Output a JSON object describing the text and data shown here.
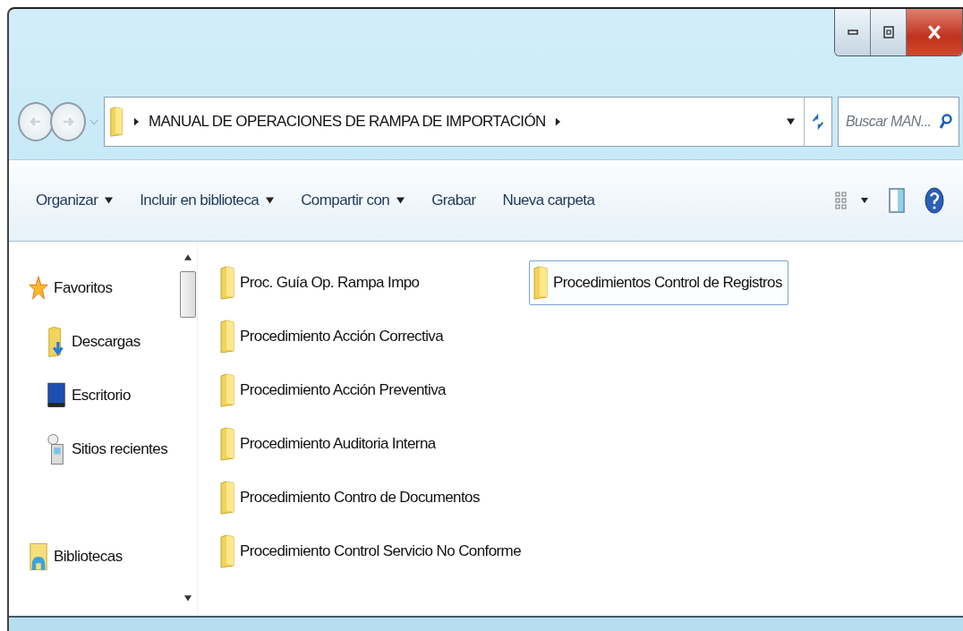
{
  "address_bar": {
    "path": "MANUAL DE OPERACIONES DE RAMPA DE IMPORTACIÓN"
  },
  "search": {
    "placeholder": "Buscar MAN..."
  },
  "toolbar": [
    {
      "label": "Organizar",
      "dropdown": true
    },
    {
      "label": "Incluir en biblioteca",
      "dropdown": true
    },
    {
      "label": "Compartir con",
      "dropdown": true
    },
    {
      "label": "Grabar",
      "dropdown": false
    },
    {
      "label": "Nueva carpeta",
      "dropdown": false
    }
  ],
  "navigation_pane": [
    {
      "kind": "group",
      "label": "Favoritos"
    },
    {
      "kind": "item",
      "label": "Descargas"
    },
    {
      "kind": "item",
      "label": "Escritorio"
    },
    {
      "kind": "item",
      "label": "Sitios recientes"
    },
    {
      "kind": "group",
      "label": "Bibliotecas"
    }
  ],
  "files": [
    {
      "name": "Proc. Guía Op. Rampa Impo",
      "selected": false
    },
    {
      "name": "Procedimiento Acción Correctiva",
      "selected": false
    },
    {
      "name": "Procedimiento Acción Preventiva",
      "selected": false
    },
    {
      "name": "Procedimiento Auditoria Interna",
      "selected": false
    },
    {
      "name": "Procedimiento Contro de Documentos",
      "selected": false
    },
    {
      "name": "Procedimiento Control Servicio No Conforme",
      "selected": false
    },
    {
      "name": "Procedimientos Control de Registros",
      "selected": true
    }
  ]
}
